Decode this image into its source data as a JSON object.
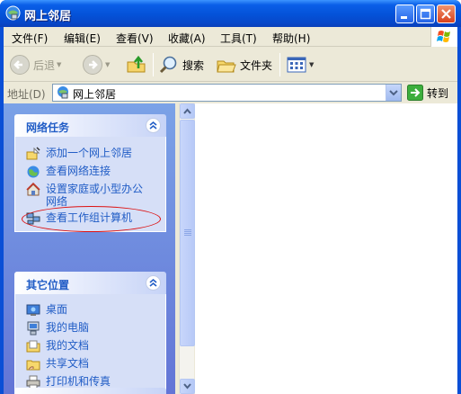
{
  "window": {
    "title": "网上邻居",
    "buttons": {
      "minimize": "minimize",
      "maximize": "maximize",
      "close": "close"
    }
  },
  "menubar": {
    "items": [
      "文件(F)",
      "编辑(E)",
      "查看(V)",
      "收藏(A)",
      "工具(T)",
      "帮助(H)"
    ]
  },
  "toolbar": {
    "back": "后退",
    "search": "搜索",
    "folders": "文件夹"
  },
  "address": {
    "label": "地址(D)",
    "value": "网上邻居",
    "go": "转到"
  },
  "tasks": {
    "network": {
      "title": "网络任务",
      "items": [
        {
          "label": "添加一个网上邻居",
          "icon": "add-network-place-icon"
        },
        {
          "label": "查看网络连接",
          "icon": "network-connections-icon"
        },
        {
          "label_line1": "设置家庭或小型办公",
          "label_line2": "网络",
          "icon": "home-network-setup-icon"
        },
        {
          "label": "查看工作组计算机",
          "icon": "workgroup-computers-icon"
        }
      ]
    },
    "other": {
      "title": "其它位置",
      "items": [
        {
          "label": "桌面",
          "icon": "desktop-icon"
        },
        {
          "label": "我的电脑",
          "icon": "my-computer-icon"
        },
        {
          "label": "我的文档",
          "icon": "my-documents-icon"
        },
        {
          "label": "共享文档",
          "icon": "shared-documents-icon"
        },
        {
          "label": "打印机和传真",
          "icon": "printers-faxes-icon"
        }
      ]
    }
  },
  "colors": {
    "titlebar": "#0452d8",
    "task_link": "#215dc6",
    "panel_bg": "#6f8ee0",
    "highlight_ellipse": "#dd1111"
  }
}
